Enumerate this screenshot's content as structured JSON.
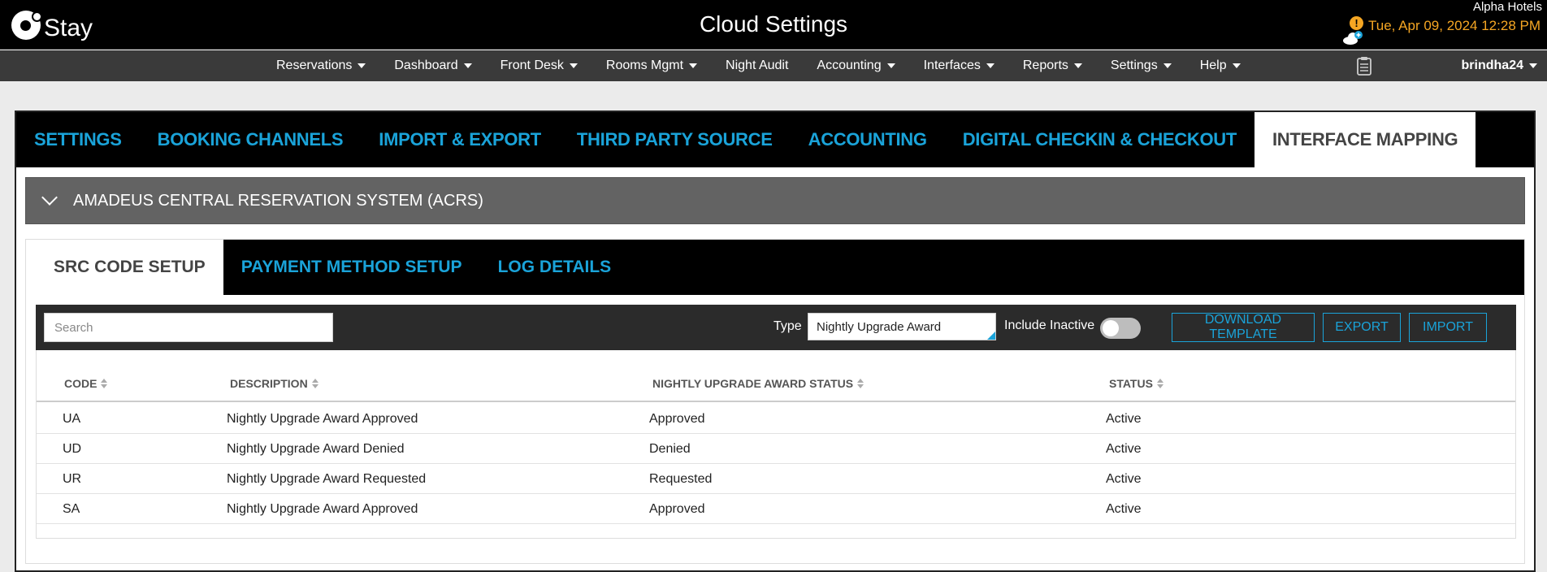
{
  "header": {
    "logo_text": "Stay",
    "title": "Cloud Settings",
    "hotel": "Alpha Hotels",
    "datetime": "Tue, Apr 09, 2024 12:28 PM",
    "warning_icon": "exclamation-circle-icon",
    "accent_color": "#f5a623"
  },
  "nav": {
    "items": [
      {
        "label": "Reservations",
        "dropdown": true
      },
      {
        "label": "Dashboard",
        "dropdown": true
      },
      {
        "label": "Front Desk",
        "dropdown": true
      },
      {
        "label": "Rooms Mgmt",
        "dropdown": true
      },
      {
        "label": "Night Audit",
        "dropdown": false
      },
      {
        "label": "Accounting",
        "dropdown": true
      },
      {
        "label": "Interfaces",
        "dropdown": true
      },
      {
        "label": "Reports",
        "dropdown": true
      },
      {
        "label": "Settings",
        "dropdown": true
      },
      {
        "label": "Help",
        "dropdown": true
      }
    ],
    "user": "brindha24"
  },
  "main_tabs": [
    {
      "label": "SETTINGS",
      "active": false
    },
    {
      "label": "BOOKING CHANNELS",
      "active": false
    },
    {
      "label": "IMPORT & EXPORT",
      "active": false
    },
    {
      "label": "THIRD PARTY SOURCE",
      "active": false
    },
    {
      "label": "ACCOUNTING",
      "active": false
    },
    {
      "label": "DIGITAL CHECKIN & CHECKOUT",
      "active": false
    },
    {
      "label": "INTERFACE MAPPING",
      "active": true
    }
  ],
  "section": {
    "title": "AMADEUS CENTRAL RESERVATION SYSTEM (ACRS)"
  },
  "sub_tabs": [
    {
      "label": "SRC CODE SETUP",
      "active": true
    },
    {
      "label": "PAYMENT METHOD SETUP",
      "active": false
    },
    {
      "label": "LOG DETAILS",
      "active": false
    }
  ],
  "toolbar": {
    "search_placeholder": "Search",
    "type_label": "Type",
    "type_value": "Nightly Upgrade Award",
    "include_inactive_label": "Include Inactive",
    "include_inactive": false,
    "download_template": "DOWNLOAD TEMPLATE",
    "export": "EXPORT",
    "import": "IMPORT",
    "accent_color": "#1aa3d9"
  },
  "table": {
    "columns": [
      "CODE",
      "DESCRIPTION",
      "NIGHTLY UPGRADE AWARD STATUS",
      "STATUS"
    ],
    "rows": [
      [
        "UA",
        "Nightly Upgrade Award Approved",
        "Approved",
        "Active"
      ],
      [
        "UD",
        "Nightly Upgrade Award Denied",
        "Denied",
        "Active"
      ],
      [
        "UR",
        "Nightly Upgrade Award Requested",
        "Requested",
        "Active"
      ],
      [
        "SA",
        "Nightly Upgrade Award Approved",
        "Approved",
        "Active"
      ]
    ]
  }
}
